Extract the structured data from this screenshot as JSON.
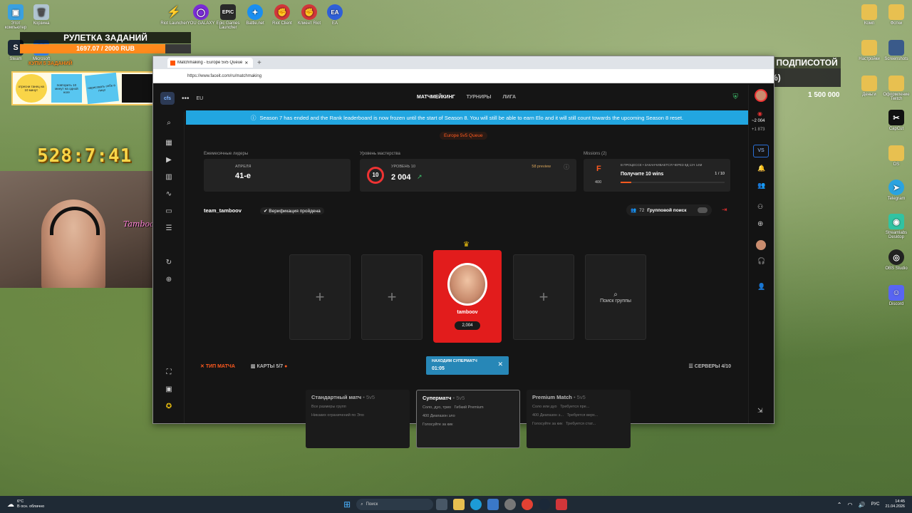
{
  "desktop": {
    "left_icons": [
      {
        "label": "Этот компьютер",
        "color": "#3aa0e0"
      },
      {
        "label": "Корзина",
        "color": "#b0c4d0"
      },
      {
        "label": "Steam",
        "color": "#1b2838"
      },
      {
        "label": "Microsoft",
        "color": "#2f7de1"
      }
    ],
    "top_icons": [
      {
        "label": "Riot Launcher",
        "color": "#e8c030"
      },
      {
        "label": "YOU GALAXY",
        "color": "#7a2bd6"
      },
      {
        "label": "Epic Games Launcher",
        "color": "#2a2a2a"
      },
      {
        "label": "Battle.net",
        "color": "#1a8ef0"
      },
      {
        "label": "Riot Client",
        "color": "#d1363a"
      },
      {
        "label": "Клиент Riot",
        "color": "#d1363a"
      },
      {
        "label": "EA",
        "color": "#2f5fd8"
      }
    ],
    "right_icons": [
      {
        "label": "Комп",
        "color": "#e8c050"
      },
      {
        "label": "Фотки",
        "color": "#e8c050"
      },
      {
        "label": "Настройки",
        "color": "#e8c050"
      },
      {
        "label": "Screenshots",
        "color": "#3a5a8a"
      },
      {
        "label": "Деньги",
        "color": "#e8c050"
      },
      {
        "label": "Оформление Twitch",
        "color": "#e8c050"
      },
      {
        "label": "CapCut",
        "color": "#111111"
      },
      {
        "label": "DS",
        "color": "#e8c050"
      },
      {
        "label": "Telegram",
        "color": "#2aa3e0"
      },
      {
        "label": "Streamlabs Desktop",
        "color": "#31c3a2"
      },
      {
        "label": "OBS Studio",
        "color": "#222222"
      },
      {
        "label": "Discord",
        "color": "#5865f2"
      }
    ]
  },
  "overlay": {
    "roulette_title": "РУЛЕТКА ЗАДАНИЙ",
    "roulette_progress": "1697.07 / 2000 RUB",
    "roulette_fraction": 0.8485,
    "roulette_sub": "КУПИ 5 ЗАДАНИЙ",
    "task_cards": [
      {
        "text": "отресни танец на 10 минут",
        "color": "#f9d548"
      },
      {
        "text": "повторить 10 минут на одной ноге",
        "color": "#58c6f0"
      },
      {
        "text": "нарисовать себе в лицо",
        "color": "#58c6f0"
      },
      {
        "text": "",
        "color": "#111111"
      },
      {
        "text": "повторить 10 минут на одной ноге",
        "color": "#58c6f0"
      }
    ],
    "timer": "528:7:41",
    "cam_name": "Tamboov",
    "survival_title": "ВЫЖИВАНИЕ НА ОСТРОВЕ С ПОДПИСОТОЙ",
    "survival_progress": "47 870.88 RUB (3%)",
    "survival_fraction": 0.03,
    "survival_min": "0",
    "survival_max": "1 500 000"
  },
  "browser": {
    "tab_title": "Matchmaking - Europe 5v5 Queue",
    "url": "https://www.faceit.com/ru/matchmaking"
  },
  "faceit": {
    "logo": "cfs",
    "region": "EU",
    "nav": [
      "МАТЧМЕЙКИНГ",
      "ТУРНИРЫ",
      "ЛИГА"
    ],
    "banner": "Season 7 has ended and the Rank leaderboard is now frozen until the start of Season 8. You will still be able to earn Elo and it will still count towards the upcoming Season 8 reset.",
    "queue": "Europe 5v5 Queue",
    "monthly_label": "Ежемесячные лидеры",
    "monthly_month": "АПРЕЛЯ",
    "monthly_rank": "41-е",
    "mastery_label": "Уровень мастерства",
    "mastery_level": "10",
    "mastery_level_label": "УРОВЕНЬ 10",
    "mastery_elo": "2 004",
    "mastery_preview": "58 preview",
    "missions_label": "Missions (2)",
    "mission_status": "В ПРОЦЕССЕ • ЗАКАНЧИВАЕТСЯ ЧЕРЕЗ 9Д 11Ч 14М",
    "mission_title": "Получите 10 wins",
    "mission_progress": "1 / 10",
    "mission_points": "400",
    "team_name": "team_tamboov",
    "verification": "Верификация пройдена",
    "party_count": "72",
    "party_search": "Групповой поиск",
    "player_name": "tamboov",
    "player_elo": "2,004",
    "find_group": "Поиск группы",
    "match_type": "ТИП МАТЧА",
    "maps": "КАРТЫ 5/7",
    "servers": "СЕРВЕРЫ 4/10",
    "find_label": "НАХОДИМ СУПЕРМАТЧ",
    "find_time": "01:05",
    "right_elo": "~2 004",
    "right_delta": "+1 873",
    "modes": [
      {
        "title": "Стандартный матч",
        "mode": "• 5v5",
        "lines": [
          "Все размеры групп",
          "Никаких ограничений по Эло"
        ]
      },
      {
        "title": "Суперматч",
        "mode": "• 5v5",
        "lines": [
          "Соло, дуо, трио",
          "Гибкий Premium",
          "400 Диапазон эло",
          "Голосуйте за кик"
        ]
      },
      {
        "title": "Premium Match",
        "mode": "• 5v5",
        "lines": [
          "Соло или дуо",
          "Требуется пре...",
          "400 Диапазон э...",
          "Требуется верх...",
          "Голосуйте за кик",
          "Требуется стат..."
        ]
      }
    ]
  },
  "taskbar": {
    "weather_temp": "6°C",
    "weather_text": "В осн. облачно",
    "search_placeholder": "Поиск",
    "lang": "РУС",
    "time": "14:45",
    "date": "21.04.2026"
  }
}
